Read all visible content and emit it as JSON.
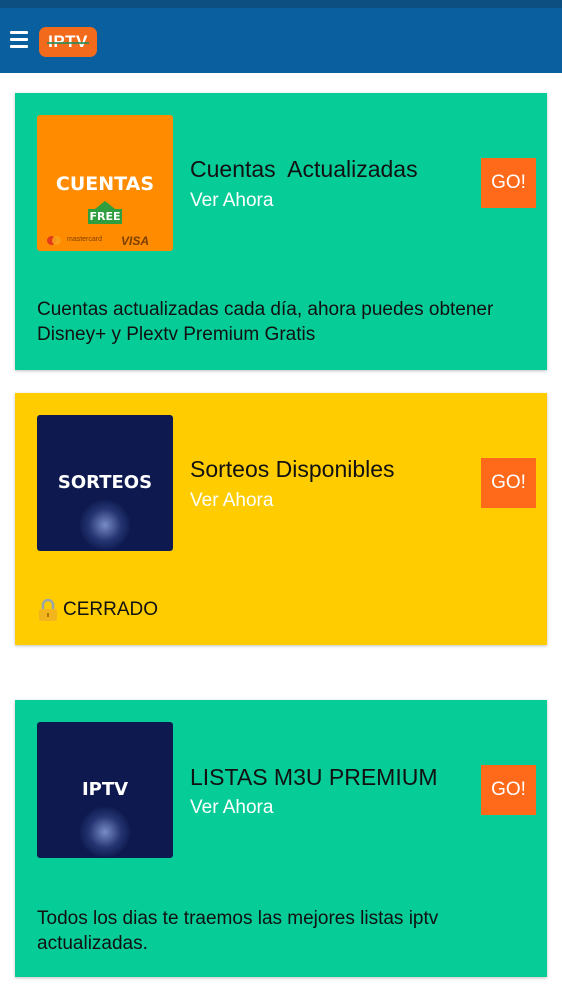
{
  "header": {
    "menu_icon": "hamburger-menu-icon",
    "logo_text": "IPTV",
    "colors": {
      "bar": "#0a5f9e",
      "logo": "#f26a1b"
    }
  },
  "cards": [
    {
      "thumb_text": "CUENTAS",
      "thumb_badge": "FREE",
      "thumb_mastercard": "mastercard",
      "thumb_visa": "VISA",
      "title": "Cuentas  Actualizadas",
      "subtitle": "Ver Ahora",
      "button": "GO!",
      "description": "Cuentas actualizadas cada día, ahora puedes obtener Disney+ y Plextv Premium Gratis",
      "color": "#06cc97"
    },
    {
      "thumb_text": "SORTEOS",
      "title": "Sorteos Disponibles",
      "subtitle": "Ver Ahora",
      "button": "GO!",
      "status_icon": "lock-icon",
      "status": "CERRADO",
      "color": "#ffcc00"
    },
    {
      "thumb_text": "IPTV",
      "title": "LISTAS M3U PREMIUM",
      "subtitle": "Ver Ahora",
      "button": "GO!",
      "description": "Todos los dias te traemos las mejores listas iptv actualizadas.",
      "color": "#06cc97"
    }
  ],
  "accent": {
    "button": "#ff6a1a"
  }
}
